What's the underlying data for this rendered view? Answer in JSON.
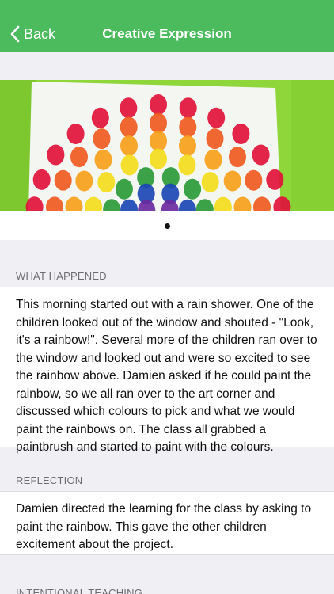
{
  "nav": {
    "back_label": "Back",
    "title": "Creative Expression"
  },
  "carousel": {
    "image_icon": "rainbow-painting-photo",
    "page_count": 1,
    "current_page": 1
  },
  "sections": [
    {
      "header": "WHAT HAPPENED",
      "body": "This morning started out with a rain shower. One of the children looked out of the window and shouted - \"Look, it's a rainbow!\". Several more of the children ran over to the window and looked out and were so excited to see the rainbow above. Damien asked if he could paint the rainbow, so we all ran over to the art corner and discussed which colours to pick and what we would paint the rainbows on. The class all grabbed a paintbrush and started to paint with the colours."
    },
    {
      "header": "REFLECTION",
      "body": "Damien directed the learning for the class by asking to paint the rainbow. This gave the other children excitement about the project."
    },
    {
      "header": "INTENTIONAL TEACHING"
    }
  ],
  "colors": {
    "nav_green": "#4cbb5e",
    "background": "#efeff4",
    "section_header": "#6d6d72"
  }
}
